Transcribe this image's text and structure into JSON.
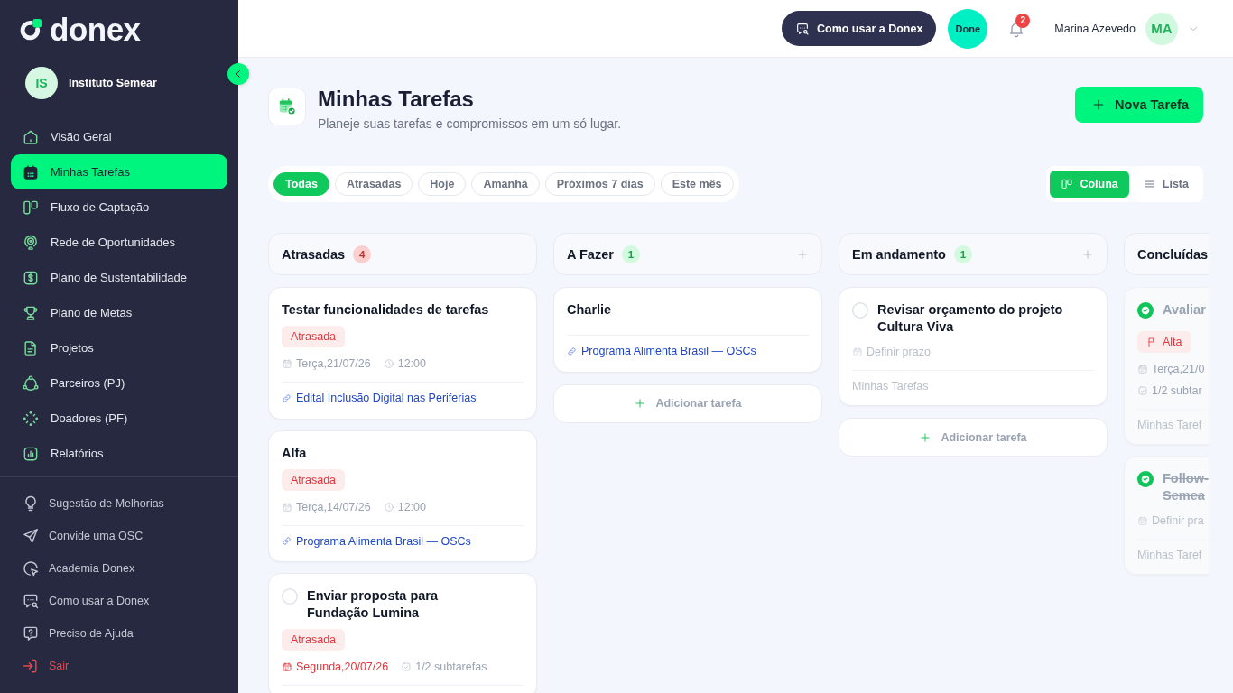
{
  "sidebar": {
    "logo": "donex",
    "org": {
      "initials": "IS",
      "name": "Instituto Semear"
    },
    "nav": [
      {
        "label": "Visão Geral",
        "selected": false
      },
      {
        "label": "Minhas Tarefas",
        "selected": true
      },
      {
        "label": "Fluxo de Captação",
        "selected": false
      },
      {
        "label": "Rede de Oportunidades",
        "selected": false
      },
      {
        "label": "Plano de Sustentabilidade",
        "selected": false
      },
      {
        "label": "Plano de Metas",
        "selected": false
      },
      {
        "label": "Projetos",
        "selected": false
      },
      {
        "label": "Parceiros (PJ)",
        "selected": false
      },
      {
        "label": "Doadores (PF)",
        "selected": false
      },
      {
        "label": "Relatórios",
        "selected": false
      }
    ],
    "footer_links": [
      {
        "label": "Sugestão de Melhorias",
        "kind": "normal"
      },
      {
        "label": "Convide uma OSC",
        "kind": "normal"
      },
      {
        "label": "Academia Donex",
        "kind": "normal"
      },
      {
        "label": "Como usar a Donex",
        "kind": "normal"
      },
      {
        "label": "Preciso de Ajuda",
        "kind": "normal"
      },
      {
        "label": "Sair",
        "kind": "danger"
      }
    ]
  },
  "topbar": {
    "help_button": "Como usar a Donex",
    "assistant_button": "Done",
    "notification_count": "2",
    "user": {
      "name": "Marina Azevedo",
      "initials": "MA"
    }
  },
  "page": {
    "title": "Minhas Tarefas",
    "subtitle": "Planeje suas tarefas e compromissos em um só lugar.",
    "new_button": "Nova Tarefa"
  },
  "filters": [
    {
      "label": "Todas",
      "selected": true
    },
    {
      "label": "Atrasadas",
      "selected": false
    },
    {
      "label": "Hoje",
      "selected": false
    },
    {
      "label": "Amanhã",
      "selected": false
    },
    {
      "label": "Próximos 7 dias",
      "selected": false
    },
    {
      "label": "Este mês",
      "selected": false
    }
  ],
  "views": [
    {
      "label": "Coluna",
      "selected": true
    },
    {
      "label": "Lista",
      "selected": false
    }
  ],
  "board": {
    "columns": [
      {
        "title": "Atrasadas",
        "count": "4",
        "kind": "overdue",
        "show_add": false,
        "cards": [
          {
            "kind": "plain",
            "done": false,
            "title": "Testar funcionalidades de tarefas",
            "badges": [
              {
                "kind": "status",
                "label": "Atrasada"
              }
            ],
            "meta": [
              {
                "kind": "date",
                "text": "Terça,21/07/26",
                "alert": false
              },
              {
                "kind": "time",
                "text": "12:00",
                "alert": false
              }
            ],
            "project": {
              "kind": "link",
              "text": "Edital Inclusão Digital nas Periferias"
            }
          },
          {
            "kind": "plain",
            "done": false,
            "title": "Alfa",
            "badges": [
              {
                "kind": "status",
                "label": "Atrasada"
              }
            ],
            "meta": [
              {
                "kind": "date",
                "text": "Terça,14/07/26",
                "alert": false
              },
              {
                "kind": "time",
                "text": "12:00",
                "alert": false
              }
            ],
            "project": {
              "kind": "link",
              "text": "Programa Alimenta Brasil — OSCs"
            }
          },
          {
            "kind": "checklist",
            "done": false,
            "title": "Enviar proposta para Fundação Lumina",
            "badges": [
              {
                "kind": "status",
                "label": "Atrasada"
              }
            ],
            "meta": [
              {
                "kind": "date",
                "text": "Segunda,20/07/26",
                "alert": true
              },
              {
                "kind": "subtasks",
                "text": "1/2 subtarefas",
                "alert": false
              }
            ]
          }
        ]
      },
      {
        "title": "A Fazer",
        "count": "1",
        "kind": "normal",
        "show_add": true,
        "cards": [
          {
            "kind": "plain",
            "done": false,
            "title": "Charlie",
            "project": {
              "kind": "link",
              "text": "Programa Alimenta Brasil — OSCs"
            }
          }
        ],
        "add_task": "Adicionar tarefa"
      },
      {
        "title": "Em andamento",
        "count": "1",
        "kind": "normal",
        "show_add": true,
        "cards": [
          {
            "kind": "checklist",
            "done": false,
            "title": "Revisar orçamento do projeto Cultura Viva",
            "meta": [
              {
                "kind": "unset_date",
                "text": "Definir prazo",
                "alert": false
              }
            ],
            "project": {
              "kind": "label",
              "text": "Minhas Tarefas"
            }
          }
        ],
        "add_task": "Adicionar tarefa"
      },
      {
        "title": "Concluídas",
        "show_add": false,
        "cards": [
          {
            "kind": "checklist",
            "done": true,
            "title": "Avaliar",
            "badges": [
              {
                "kind": "priority",
                "label": "Alta"
              }
            ],
            "meta": [
              {
                "kind": "date",
                "text": "Terça,21/0",
                "alert": false
              },
              {
                "kind": "subtasks",
                "text": "1/2 subtar",
                "alert": false
              }
            ],
            "project": {
              "kind": "label",
              "text": "Minhas Taref"
            }
          },
          {
            "kind": "checklist",
            "done": true,
            "title": "Follow-\nSemea",
            "meta": [
              {
                "kind": "unset_date",
                "text": "Definir pra",
                "alert": false
              }
            ],
            "project": {
              "kind": "label",
              "text": "Minhas Taref"
            }
          }
        ]
      }
    ]
  }
}
